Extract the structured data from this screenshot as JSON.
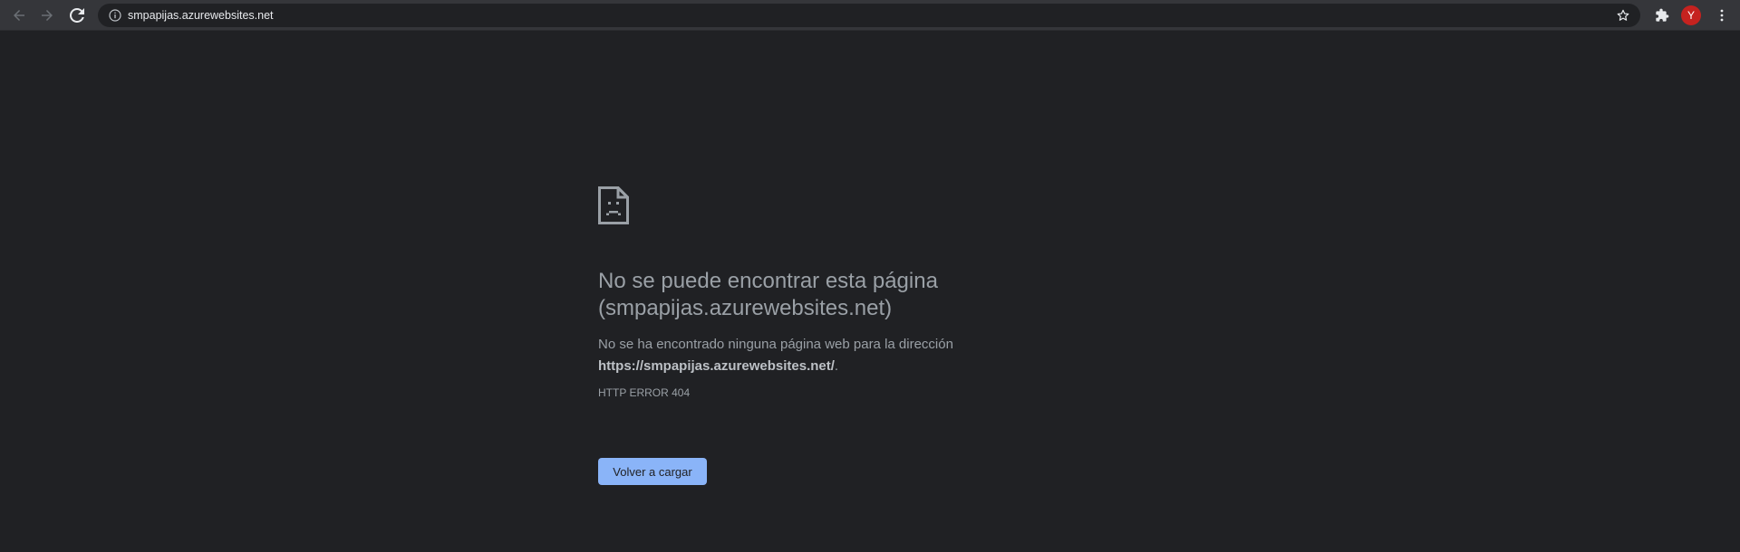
{
  "browser": {
    "url": "smpapijas.azurewebsites.net",
    "profile_initial": "Y",
    "colors": {
      "toolbar": "#35363a",
      "omnibox": "#202124",
      "icon": "#9aa0a6",
      "icon_active": "#e8eaed",
      "avatar": "#c5221f"
    },
    "icons": [
      "back-arrow-icon",
      "forward-arrow-icon",
      "reload-icon",
      "info-icon",
      "star-icon",
      "extensions-icon",
      "more-vert-icon"
    ]
  },
  "page": {
    "icon": "sad-page-icon",
    "heading_line1": "No se puede encontrar esta página",
    "heading_line2": "(smpapijas.azurewebsites.net)",
    "desc_prefix": "No se ha encontrado ninguna página web para la dirección",
    "desc_url": "https://smpapijas.azurewebsites.net/",
    "desc_suffix": ".",
    "error_code": "HTTP ERROR 404",
    "reload_label": "Volver a cargar",
    "colors": {
      "background": "#202124",
      "text": "#9aa0a6",
      "button": "#8ab4f8"
    }
  }
}
